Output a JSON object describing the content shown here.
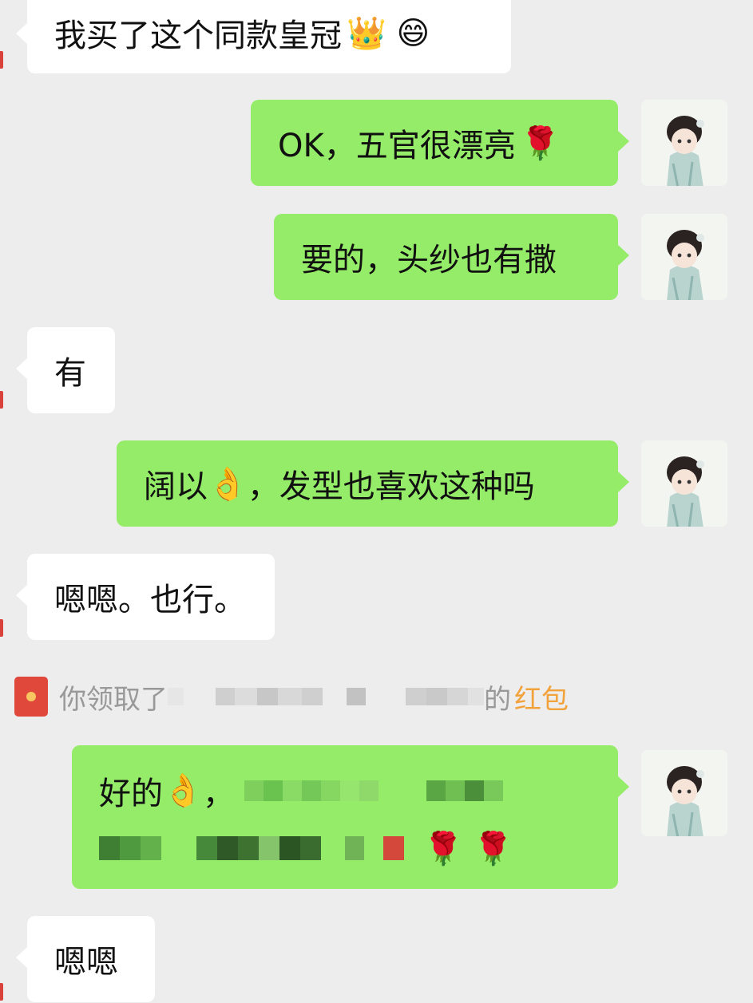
{
  "colors": {
    "background": "#ededed",
    "incoming_bubble": "#ffffff",
    "outgoing_bubble": "#95ec69",
    "system_text": "#999999",
    "red_packet_link": "#f2a23a",
    "red_packet_icon": "#e0483c"
  },
  "messages": [
    {
      "side": "left",
      "text": "我买了这个同款皇冠",
      "emojis": "👑 😄"
    },
    {
      "side": "right",
      "text": "OK，五官很漂亮",
      "emojis": "🌹"
    },
    {
      "side": "right",
      "text": "要的，头纱也有撒"
    },
    {
      "side": "left",
      "text": "有"
    },
    {
      "side": "right",
      "text_before": "阔以",
      "emoji": "👌",
      "text_after": "，发型也喜欢这种吗"
    },
    {
      "side": "left",
      "text": "嗯嗯。也行。"
    },
    {
      "side": "right",
      "text_before": "好的",
      "emoji": "👌",
      "text_after": "，",
      "redacted": true,
      "trailing_emojis": "🌹 🌹"
    },
    {
      "side": "left",
      "text": "嗯嗯"
    }
  ],
  "system_notice": {
    "icon": "red-packet-icon",
    "prefix": "你领取了",
    "suffix": "的",
    "link": "红包"
  },
  "avatar_icon": "avatar-girl-icon"
}
